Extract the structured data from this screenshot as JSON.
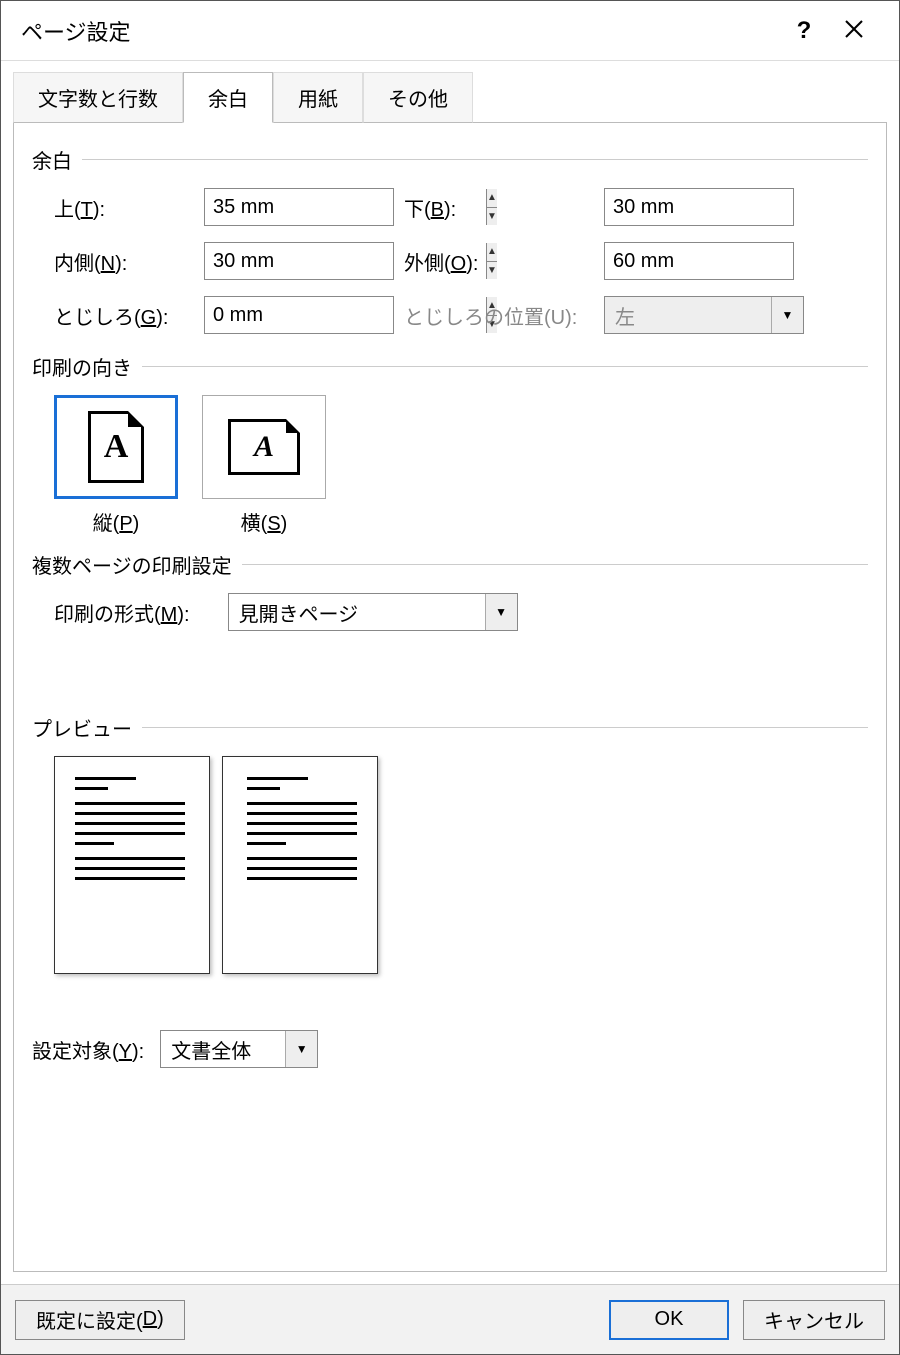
{
  "title": "ページ設定",
  "tabs": [
    "文字数と行数",
    "余白",
    "用紙",
    "その他"
  ],
  "active_tab": "余白",
  "groups": {
    "margins": "余白",
    "orientation": "印刷の向き",
    "multipage": "複数ページの印刷設定",
    "preview": "プレビュー"
  },
  "margins": {
    "top_label": "上(T):",
    "top_value": "35 mm",
    "bottom_label": "下(B):",
    "bottom_value": "30 mm",
    "inside_label": "内側(N):",
    "inside_value": "30 mm",
    "outside_label": "外側(O):",
    "outside_value": "60 mm",
    "gutter_label": "とじしろ(G):",
    "gutter_value": "0 mm",
    "gutter_pos_label": "とじしろの位置(U):",
    "gutter_pos_value": "左"
  },
  "orientation": {
    "portrait_label": "縦(P)",
    "landscape_label": "横(S)",
    "selected": "portrait"
  },
  "multipage": {
    "label": "印刷の形式(M):",
    "value": "見開きページ"
  },
  "target": {
    "label": "設定対象(Y):",
    "value": "文書全体"
  },
  "buttons": {
    "set_default": "既定に設定(D)",
    "ok": "OK",
    "cancel": "キャンセル"
  }
}
